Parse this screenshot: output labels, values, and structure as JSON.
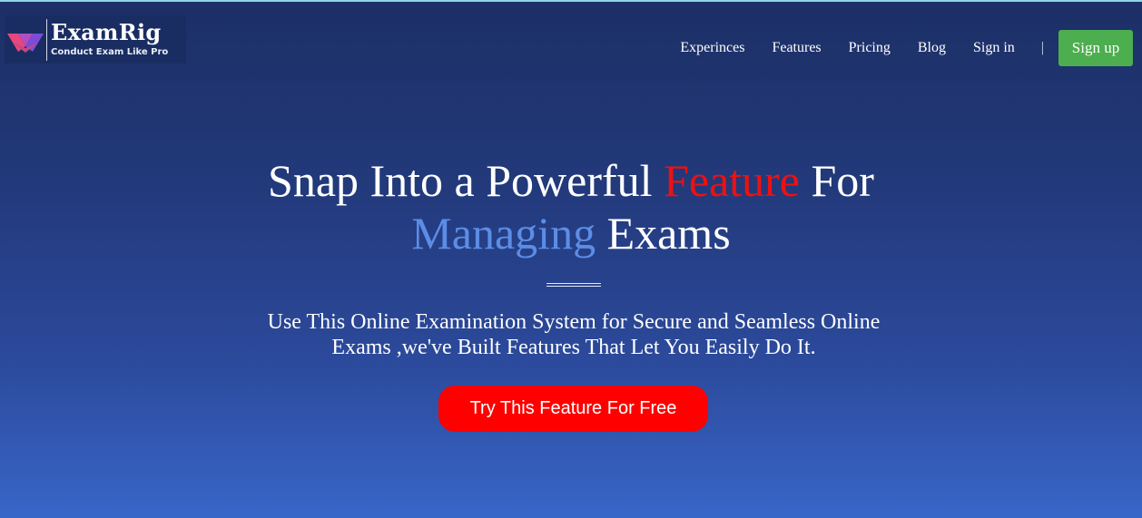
{
  "brand": {
    "name": "ExamRig",
    "tagline": "Conduct Exam Like Pro",
    "logo_icon": "examrig-logo-icon",
    "colors": {
      "pink": "#e8467c",
      "purple": "#7a4cd8"
    }
  },
  "nav": {
    "items": [
      {
        "label": "Experinces"
      },
      {
        "label": "Features"
      },
      {
        "label": "Pricing"
      },
      {
        "label": "Blog"
      },
      {
        "label": "Sign in"
      }
    ],
    "separator": "|",
    "signup_label": "Sign up",
    "signup_color": "#4cae4f"
  },
  "hero": {
    "title_part1": "Snap Into a Powerful ",
    "title_highlight1": "Feature",
    "title_part2": " For",
    "title_highlight2": "Managing",
    "title_part3": " Exams",
    "highlight1_color": "#ee1111",
    "highlight2_color": "#5c8de6",
    "subtitle_line1": "Use This Online Examination System for Secure and Seamless Online",
    "subtitle_line2": "Exams ,we've Built Features That Let You Easily Do It.",
    "cta_label": "Try This Feature For Free",
    "cta_color": "#ff0000"
  }
}
